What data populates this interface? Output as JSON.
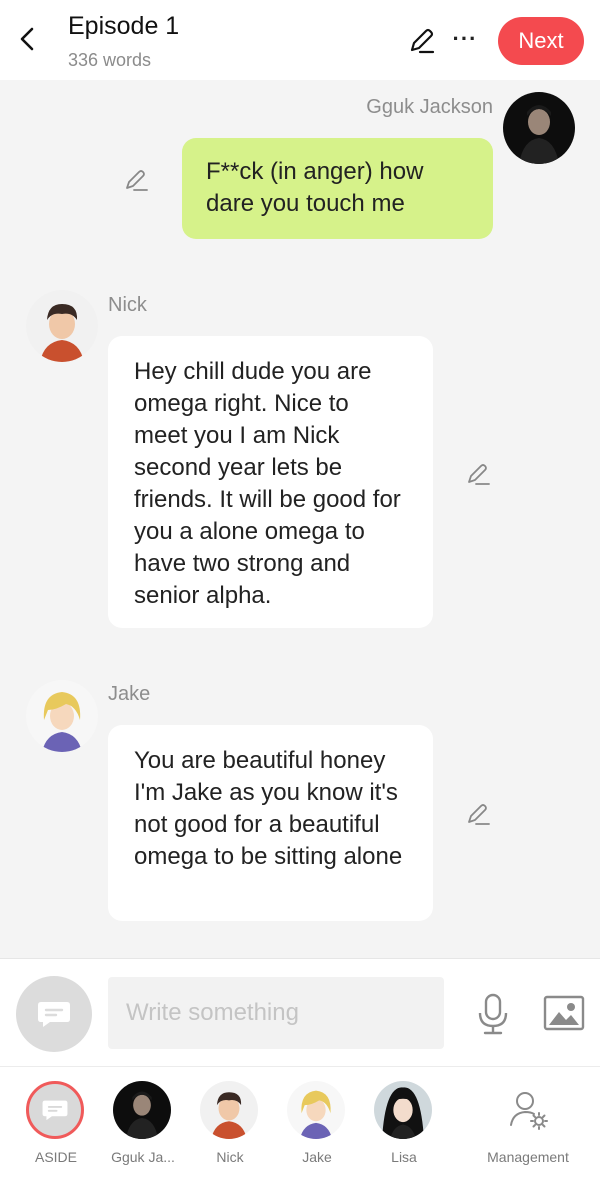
{
  "header": {
    "title": "Episode 1",
    "word_count": "336 words",
    "more_label": "···",
    "next_label": "Next"
  },
  "messages": [
    {
      "speaker": "Gguk Jackson",
      "text": "F**ck (in anger) how dare you touch me",
      "side": "right",
      "bubble_color": "#d6f28a"
    },
    {
      "speaker": "Nick",
      "text": "Hey chill dude you are omega right. Nice to meet you I am Nick second year lets be friends. It will be good for you a alone omega to have two strong and senior alpha.",
      "side": "left",
      "bubble_color": "#ffffff"
    },
    {
      "speaker": "Jake",
      "text": "You are beautiful honey I'm Jake as you know it's not good for a beautiful omega to be sitting alone",
      "side": "left",
      "bubble_color": "#ffffff"
    }
  ],
  "composer": {
    "placeholder": "Write something",
    "value": ""
  },
  "characters": [
    {
      "label": "ASIDE"
    },
    {
      "label": "Gguk Ja..."
    },
    {
      "label": "Nick"
    },
    {
      "label": "Jake"
    },
    {
      "label": "Lisa"
    },
    {
      "label": "Management"
    }
  ],
  "colors": {
    "accent": "#f44a4f",
    "bubble_green": "#d6f28a",
    "background": "#f4f4f4"
  },
  "icons": [
    "chevron-left-icon",
    "pencil-icon",
    "more-icon",
    "message-icon",
    "microphone-icon",
    "image-icon",
    "user-settings-icon"
  ]
}
